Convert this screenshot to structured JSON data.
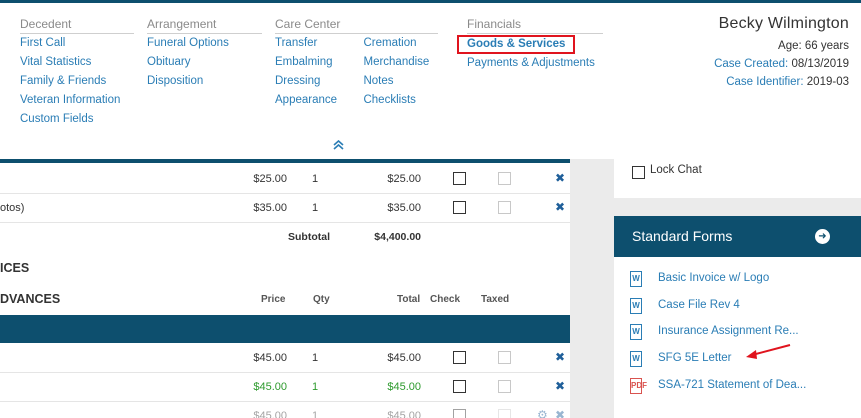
{
  "nav": {
    "decedent": {
      "header": "Decedent",
      "links": [
        "First Call",
        "Vital Statistics",
        "Family & Friends",
        "Veteran Information",
        "Custom Fields"
      ]
    },
    "arrangement": {
      "header": "Arrangement",
      "links": [
        "Funeral Options",
        "Obituary",
        "Disposition"
      ]
    },
    "care_center": {
      "header": "Care Center",
      "links_a": [
        "Transfer",
        "Embalming",
        "Dressing",
        "Appearance"
      ],
      "links_b": [
        "Cremation",
        "Merchandise",
        "Notes",
        "Checklists"
      ]
    },
    "financials": {
      "header": "Financials",
      "links": [
        "Goods & Services",
        "Payments & Adjustments"
      ]
    }
  },
  "case": {
    "name": "Becky Wilmington",
    "age": "Age: 66 years",
    "created_label": "Case Created:",
    "created_value": "08/13/2019",
    "id_label": "Case Identifier:",
    "id_value": "2019-03"
  },
  "collapse_icon": "double-chevron-up-icon",
  "table": {
    "rows_top": [
      {
        "desc": "",
        "price": "$25.00",
        "qty": "1",
        "total": "$25.00"
      },
      {
        "desc": "otos)",
        "price": "$35.00",
        "qty": "1",
        "total": "$35.00"
      }
    ],
    "subtotal_label": "Subtotal",
    "subtotal_value": "$4,400.00",
    "section_services": "ICES",
    "section_advances": "DVANCES",
    "col_headers": {
      "price": "Price",
      "qty": "Qty",
      "total": "Total",
      "check": "Check",
      "taxed": "Taxed"
    },
    "rows_bottom": [
      {
        "price": "$45.00",
        "qty": "1",
        "total": "$45.00"
      },
      {
        "price": "$45.00",
        "qty": "1",
        "total": "$45.00"
      },
      {
        "price": "$45.00",
        "qty": "1",
        "total": "$45.00"
      }
    ]
  },
  "sidebar": {
    "lock_chat": "Lock Chat",
    "forms_title": "Standard Forms",
    "forms": [
      {
        "label": "Basic Invoice w/ Logo",
        "type": "W"
      },
      {
        "label": "Case File Rev 4",
        "type": "W"
      },
      {
        "label": "Insurance Assignment Re...",
        "type": "W"
      },
      {
        "label": "SFG 5E Letter",
        "type": "W"
      },
      {
        "label": "SSA-721 Statement of Dea...",
        "type": "PDF"
      }
    ]
  },
  "colors": {
    "brand": "#0d4f6e",
    "link": "#2a7db5",
    "highlight": "#e0141e",
    "green": "#2d9a2d"
  }
}
